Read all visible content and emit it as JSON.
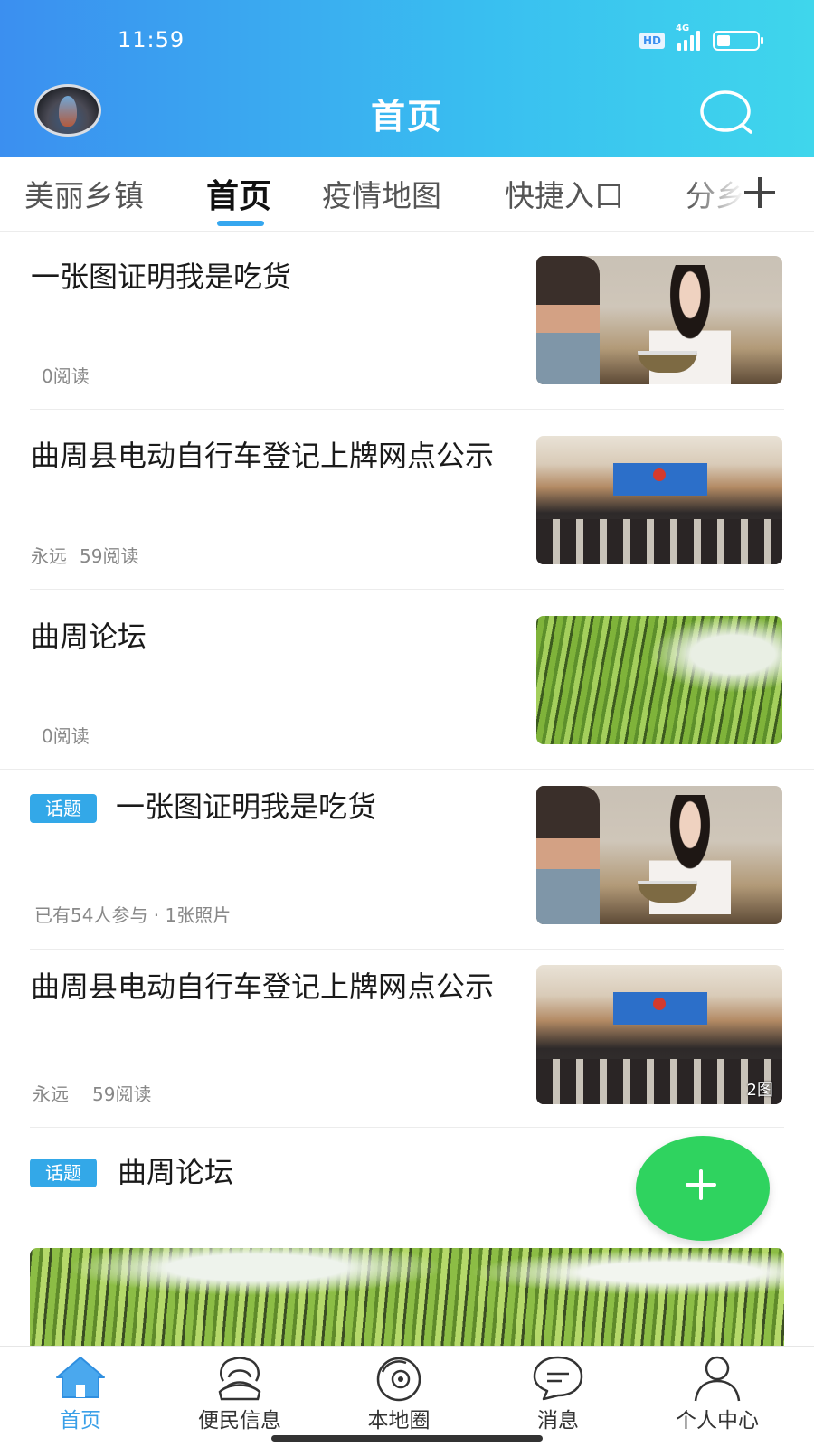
{
  "status_bar": {
    "time": "11:59",
    "hd": "HD",
    "network": "4G"
  },
  "header": {
    "title": "首页"
  },
  "tabs": [
    {
      "label": "美丽乡镇"
    },
    {
      "label": "首页"
    },
    {
      "label": "疫情地图"
    },
    {
      "label": "快捷入口"
    },
    {
      "label": "分乡"
    }
  ],
  "feed": [
    {
      "title": "一张图证明我是吃货",
      "meta": "0阅读"
    },
    {
      "title": "曲周县电动自行车登记上牌网点公示",
      "author": "永远",
      "meta": "59阅读"
    },
    {
      "title": "曲周论坛",
      "meta": "0阅读"
    },
    {
      "badge": "话题",
      "title": "一张图证明我是吃货",
      "meta": "已有54人参与 · 1张照片"
    },
    {
      "title": "曲周县电动自行车登记上牌网点公示",
      "author": "永远",
      "meta": "59阅读",
      "image_count": "2图"
    },
    {
      "badge": "话题",
      "title": "曲周论坛"
    }
  ],
  "bottom_nav": [
    {
      "label": "首页",
      "icon": "home-icon",
      "active": true
    },
    {
      "label": "便民信息",
      "icon": "service-icon"
    },
    {
      "label": "本地圈",
      "icon": "local-circle-icon"
    },
    {
      "label": "消息",
      "icon": "message-icon"
    },
    {
      "label": "个人中心",
      "icon": "person-icon"
    }
  ],
  "colors": {
    "header_start": "#3b8ff0",
    "header_end": "#3fd6ec",
    "accent": "#36a7ef",
    "fab": "#2fd35f"
  }
}
